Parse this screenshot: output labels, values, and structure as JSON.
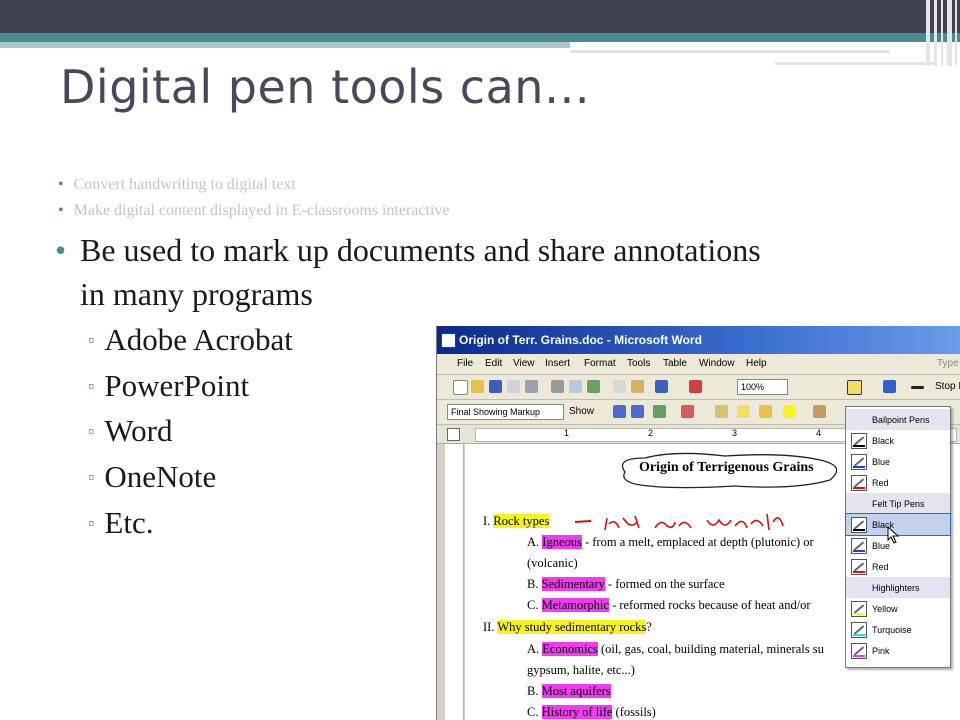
{
  "slide": {
    "title": "Digital pen tools can…",
    "small_bullets": [
      "Convert handwriting to digital text",
      "Make digital content displayed in E-classrooms interactive"
    ],
    "main_bullet": "Be used to mark up documents and share annotations in many programs",
    "sub_bullets": [
      "Adobe Acrobat",
      "PowerPoint",
      "Word",
      "OneNote",
      "Etc."
    ],
    "bullet_char": "•",
    "sub_bullet_char": "▫",
    "accent_color": "#4b8a8e",
    "title_color": "#46495a"
  },
  "word_window": {
    "title": "Origin of Terr. Grains.doc - Microsoft Word",
    "menu": [
      "File",
      "Edit",
      "View",
      "Insert",
      "Format",
      "Tools",
      "Table",
      "Window",
      "Help"
    ],
    "zoom": "100%",
    "stop_label": "Stop I",
    "type_hint": "Type",
    "markup_mode": "Final Showing Markup",
    "show_label": "Show",
    "ruler_numbers": [
      "1",
      "2",
      "3",
      "4"
    ],
    "document": {
      "title": "Origin of Terrigenous Grains",
      "line1_num": "I.",
      "line1_hl": "Rock types",
      "handwriting": "ink on word file",
      "lineA_num": "A.",
      "lineA_hl": "Igneous",
      "lineA_rest": "- from a melt, emplaced at depth (plutonic) or",
      "lineA2": "(volcanic)",
      "lineB_num": "B.",
      "lineB_hl": "Sedimentary",
      "lineB_rest": "- formed on the surface",
      "lineC_num": "C.",
      "lineC_hl": "Metamorphic",
      "lineC_rest": "- reformed rocks because of heat and/or",
      "line2_num": "II.",
      "line2_hl": "Why study sedimentary rocks",
      "line2_rest": "?",
      "line2A_num": "A.",
      "line2A_hl": "Economics",
      "line2A_rest": "(oil, gas, coal, building material, minerals su",
      "line2A2": "gypsum, halite, etc...)",
      "line2B_num": "B.",
      "line2B_hl": "Most aquifers",
      "line2C_num": "C.",
      "line2C_hl": "History of life",
      "line2C_rest": "(fossils)"
    },
    "pen_menu": [
      {
        "label": "Ballpoint Pens",
        "header": true
      },
      {
        "label": "Black",
        "color": "#000000"
      },
      {
        "label": "Blue",
        "color": "#1f3fd0"
      },
      {
        "label": "Red",
        "color": "#e01010"
      },
      {
        "label": "Felt Tip Pens",
        "header": true
      },
      {
        "label": "Black",
        "color": "#000000",
        "selected": true
      },
      {
        "label": "Blue",
        "color": "#1f3fd0"
      },
      {
        "label": "Red",
        "color": "#e01010"
      },
      {
        "label": "Highlighters",
        "header": true
      },
      {
        "label": "Yellow",
        "color": "#f7f31c"
      },
      {
        "label": "Turquoise",
        "color": "#22e0e0"
      },
      {
        "label": "Pink",
        "color": "#f03cf0"
      }
    ]
  }
}
